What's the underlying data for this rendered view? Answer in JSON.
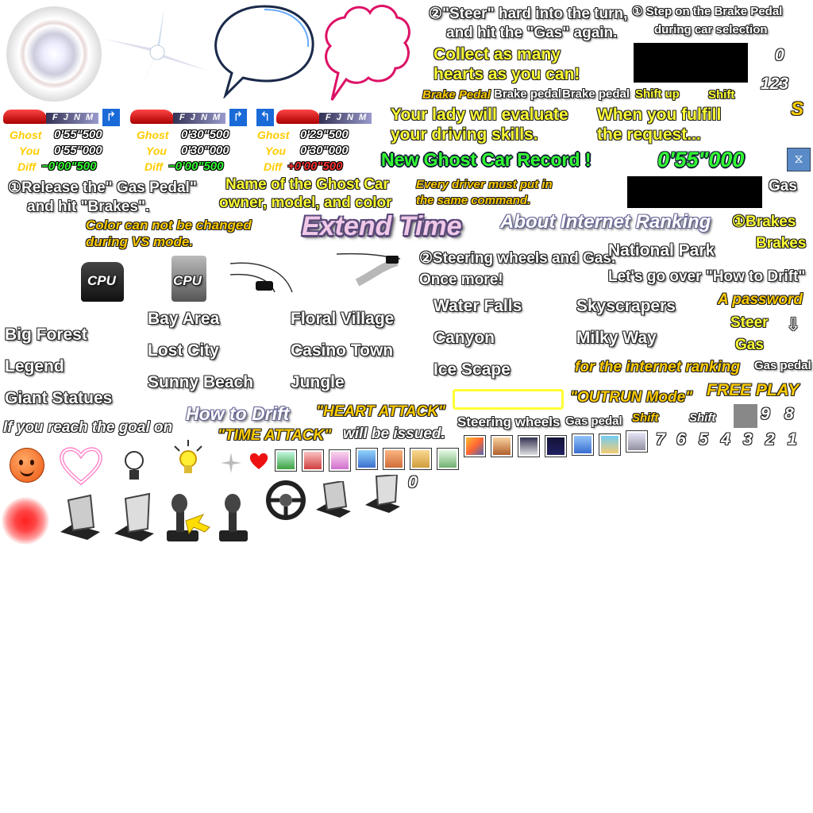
{
  "instructions": {
    "steer_hard": "②\"Steer\" hard into the turn,",
    "hit_gas_again": "and hit the \"Gas\" again.",
    "step_brake_1": "① Step on the Brake Pedal",
    "step_brake_2": "during car selection",
    "collect_1": "Collect as many",
    "collect_2": "hearts as you can!",
    "lady_1": "Your lady will evaluate",
    "lady_2": "your driving skills.",
    "fulfill_1": "When you fulfill",
    "fulfill_2": "the request...",
    "release_1": "①Release the\" Gas Pedal\"",
    "release_2": "and hit \"Brakes\".",
    "ghost_name_1": "Name of the Ghost Car",
    "ghost_name_2": "owner, model, and color",
    "same_cmd_1": "Every driver must put in",
    "same_cmd_2": "the same command.",
    "color_vs_1": "Color can not be changed",
    "color_vs_2": "during VS mode.",
    "steering_gas": "②Steering wheels and Gas.",
    "once_more": "Once more!",
    "lets_go": "Let's go over \"How to Drift\"",
    "reach_goal": "If you reach the goal on",
    "heart_attack": "\"HEART ATTACK\"",
    "time_attack": "\"TIME ATTACK\"",
    "will_be_issued": "will be issued.",
    "for_internet": "for the internet ranking",
    "a_password": "A password"
  },
  "control_labels": {
    "brake_pedal_italic": "Brake Pedal",
    "brake_pedal_1": "Brake pedal",
    "brake_pedal_2": "Brake pedal",
    "shift_up": "Shift up",
    "shift": "Shift",
    "brakes_1": "①Brakes",
    "brakes_2": "Brakes",
    "gas_right": "Gas",
    "steer": "Steer",
    "gas": "Gas",
    "gas_pedal": "Gas pedal",
    "steering_wheels": "Steering wheels",
    "gas_pedal_2": "Gas pedal",
    "shift_orange": "Shift",
    "shift_white": "Shift",
    "down_arrow": "⇩"
  },
  "titles": {
    "new_record": "New Ghost Car Record !",
    "extend_time": "Extend Time",
    "about_ranking": "About Internet Ranking",
    "how_to_drift": "How to Drift",
    "outrun_mode": "\"OUTRUN Mode\"",
    "free_play": "FREE PLAY",
    "record_time": "0'55\"000"
  },
  "counters": {
    "zero": "0",
    "one_two_three": "123",
    "s": "S",
    "nine": "9",
    "eight": "8",
    "digits": [
      "7",
      "6",
      "5",
      "4",
      "3",
      "2",
      "1"
    ],
    "zero_bottom": "0"
  },
  "courses": {
    "col1": [
      "Big Forest",
      "Legend",
      "Giant Statues"
    ],
    "col2": [
      "Bay Area",
      "Lost City",
      "Sunny Beach"
    ],
    "col3": [
      "Floral Village",
      "Casino Town",
      "Jungle"
    ],
    "col4": [
      "Water Falls",
      "Canyon",
      "Ice Scape"
    ],
    "col5": [
      "Skyscrapers",
      "Milky Way"
    ],
    "national_park": "National Park"
  },
  "ghost_panels": [
    {
      "gears": "F J N M",
      "ghost_label": "Ghost",
      "ghost_time": "0'55\"500",
      "you_label": "You",
      "you_time": "0'55\"000",
      "diff_label": "Diff",
      "diff_time": "−0'00\"500",
      "diff_color": "#33ff33"
    },
    {
      "gears": "F J N M",
      "ghost_label": "Ghost",
      "ghost_time": "0'30\"500",
      "you_label": "You",
      "you_time": "0'30\"000",
      "diff_label": "Diff",
      "diff_time": "−0'00\"500",
      "diff_color": "#33ff33"
    },
    {
      "gears": "F J N M",
      "ghost_label": "Ghost",
      "ghost_time": "0'29\"500",
      "you_label": "You",
      "you_time": "0'30\"000",
      "diff_label": "Diff",
      "diff_time": "+0'00\"500",
      "diff_color": "#ff3333"
    }
  ],
  "cpu_labels": [
    "CPU",
    "CPU"
  ],
  "colors": {
    "yellow_text": "#ffff33",
    "green_text": "#33ff33",
    "orange_text": "#ffcc00",
    "lavender_title": "#e8d0ff",
    "car_red": "#cc1111",
    "outline": "#222222"
  }
}
